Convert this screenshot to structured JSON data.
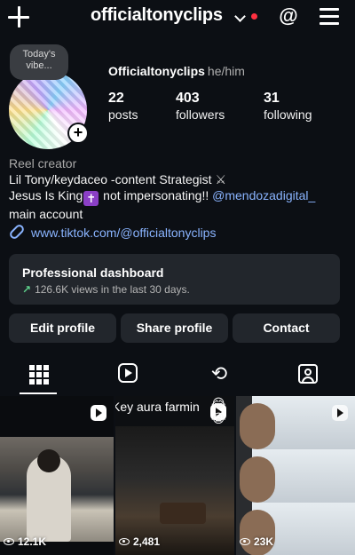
{
  "header": {
    "username": "officialtonyclips"
  },
  "profile": {
    "note": "Today's vibe...",
    "display_name": "Officialtonyclips",
    "pronouns": "he/him",
    "stats": {
      "posts": {
        "value": "22",
        "label": "posts"
      },
      "followers": {
        "value": "403",
        "label": "followers"
      },
      "following": {
        "value": "31",
        "label": "following"
      }
    },
    "bio": {
      "category": "Reel creator",
      "line1": "Lil Tony/keydaceo -content Strategist",
      "line1_emoji": "⚔",
      "line2_start": "Jesus Is King",
      "line2_emoji": "✝",
      "line2_end": "not impersonating!!",
      "mention": "@mendozadigital_",
      "line3": "main account"
    },
    "link": "www.tiktok.com/@officialtonyclips"
  },
  "dashboard": {
    "title": "Professional dashboard",
    "subtitle": "126.6K views in the last 30 days."
  },
  "buttons": {
    "edit": "Edit profile",
    "share": "Share profile",
    "contact": "Contact"
  },
  "tabs": [
    {
      "icon": "grid-icon",
      "active": true
    },
    {
      "icon": "reels-icon",
      "active": false
    },
    {
      "icon": "repost-icon",
      "active": false
    },
    {
      "icon": "tagged-icon",
      "active": false
    }
  ],
  "posts": [
    {
      "views": "12.1K",
      "caption": ""
    },
    {
      "views": "2,481",
      "caption": "Key aura farmin",
      "emoji": "😂😭"
    },
    {
      "views": "23K",
      "caption": ""
    }
  ],
  "colors": {
    "background": "#0c0f14",
    "card": "#22262c",
    "link": "#8ab4ff",
    "notification_dot": "#ff3040",
    "trend_up": "#5fd38d"
  }
}
